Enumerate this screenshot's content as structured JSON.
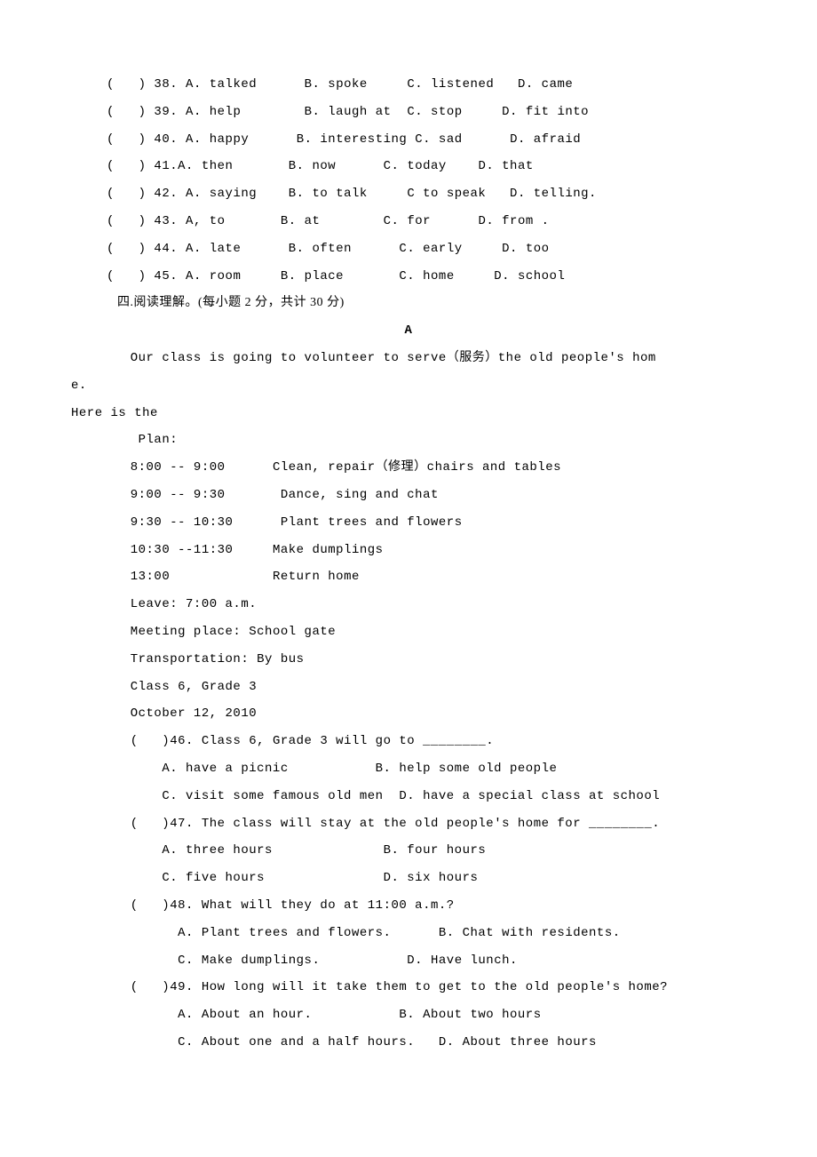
{
  "questions": [
    {
      "num": "38",
      "a": "A. talked",
      "b": "B. spoke",
      "c": "C. listened",
      "d": "D. came"
    },
    {
      "num": "39",
      "a": "A. help",
      "b": "B. laugh at",
      "c": "C. stop",
      "d": "D. fit into"
    },
    {
      "num": "40",
      "a": "A. happy",
      "b": "B. interesting",
      "c": "C. sad",
      "d": "D. afraid"
    },
    {
      "num": "41",
      "a": "A. then",
      "b": "B. now",
      "c": "C. today",
      "d": "D. that",
      "sep": "."
    },
    {
      "num": "42",
      "a": "A. saying",
      "b": "B. to talk",
      "c": "C to speak",
      "d": "D. telling."
    },
    {
      "num": "43",
      "a": "A, to",
      "b": "B. at",
      "c": "C. for",
      "d": "D. from ."
    },
    {
      "num": "44",
      "a": "A. late",
      "b": "B. often",
      "c": "C. early",
      "d": "D. too"
    },
    {
      "num": "45",
      "a": "A. room",
      "b": "B. place",
      "c": "C. home",
      "d": "D. school"
    }
  ],
  "section4_title": "四.阅读理解。(每小题 2 分，共计 30 分)",
  "passage_label": "A",
  "passage_intro1": "Our class is going to volunteer to serve（服务）the old people's hom",
  "passage_intro2": "e.",
  "passage_intro3": "Here is the",
  "plan_label": "Plan:",
  "plan_rows": [
    {
      "time": "8:00 -- 9:00",
      "activity": "Clean, repair（修理）chairs and tables"
    },
    {
      "time": "9:00 -- 9:30",
      "activity": "Dance, sing and chat"
    },
    {
      "time": "9:30 -- 10:30",
      "activity": "Plant trees and flowers"
    },
    {
      "time": "10:30 --11:30",
      "activity": "Make dumplings"
    },
    {
      "time": "13:00",
      "activity": "Return home"
    }
  ],
  "leave": "Leave: 7:00 a.m.",
  "meeting": "Meeting place: School gate",
  "transport": "Transportation: By bus",
  "class_info": "Class 6, Grade 3",
  "date_info": "October 12, 2010",
  "reading_q": [
    {
      "num": "46",
      "stem": "Class 6, Grade 3 will go to ________.",
      "a": "A. have a picnic",
      "b": "B. help some old people",
      "c": "C. visit some famous old men",
      "d": "D. have a special class at school"
    },
    {
      "num": "47",
      "stem": "The class will stay at the old people's home for ________.",
      "a": "A. three hours",
      "b": "B. four hours",
      "c": "C. five hours",
      "d": "D. six hours"
    },
    {
      "num": "48",
      "stem": "What will they do at 11:00 a.m.?",
      "a": "A. Plant trees and flowers.",
      "b": "B. Chat with residents.",
      "c": "C. Make dumplings.",
      "d": "D. Have lunch."
    },
    {
      "num": "49",
      "stem": "How long will it take them to get to the old people's home?",
      "a": "A. About an hour.",
      "b": "B. About two hours",
      "c": "C. About one and a half hours.",
      "d": "D. About three hours"
    }
  ]
}
